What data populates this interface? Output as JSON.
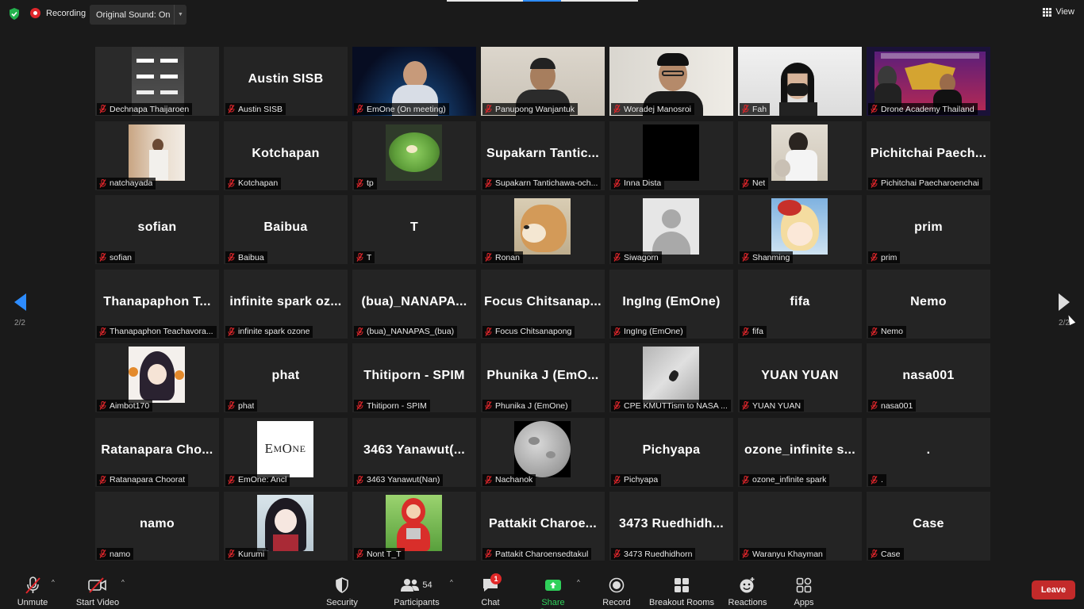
{
  "topbar": {
    "recording_label": "Recording",
    "original_sound_label": "Original Sound: On",
    "view_label": "View"
  },
  "participants": [
    {
      "big": "",
      "name": "Dechnapa Thaijaroen",
      "media": "video-lights"
    },
    {
      "big": "Austin SISB",
      "name": "Austin SISB"
    },
    {
      "big": "",
      "name": "EmOne (On meeting)",
      "media": "video-space"
    },
    {
      "big": "",
      "name": "Panupong Wanjantuk",
      "media": "video-person-light"
    },
    {
      "big": "",
      "name": "Woradej Manosroi",
      "media": "video-person-glasses"
    },
    {
      "big": "",
      "name": "Fah",
      "media": "video-person-mask"
    },
    {
      "big": "",
      "name": "Drone Academy Thailand",
      "media": "video-drone",
      "active": true
    },
    {
      "big": "",
      "name": "natchayada",
      "media": "photo-room"
    },
    {
      "big": "Kotchapan",
      "name": "Kotchapan"
    },
    {
      "big": "",
      "name": "tp",
      "media": "photo-salad"
    },
    {
      "big": "Supakarn  Tantic...",
      "name": "Supakarn Tantichawa-och..."
    },
    {
      "big": "",
      "name": "Inna Dista",
      "media": "photo-black"
    },
    {
      "big": "",
      "name": "Net",
      "media": "photo-net"
    },
    {
      "big": "Pichitchai  Paech...",
      "name": "Pichitchai Paecharoenchai"
    },
    {
      "big": "sofian",
      "name": "sofian"
    },
    {
      "big": "Baibua",
      "name": "Baibua"
    },
    {
      "big": "T",
      "name": "T"
    },
    {
      "big": "",
      "name": "Ronan",
      "media": "photo-shiba"
    },
    {
      "big": "",
      "name": "Siwagorn",
      "media": "photo-default"
    },
    {
      "big": "",
      "name": "Shanming",
      "media": "photo-anime-blonde"
    },
    {
      "big": "prim",
      "name": "prim"
    },
    {
      "big": "Thanapaphon  T...",
      "name": "Thanapaphon Teachavora..."
    },
    {
      "big": "infinite spark oz...",
      "name": "infinite spark ozone"
    },
    {
      "big": "(bua)_NANAPA...",
      "name": "(bua)_NANAPAS_(bua)"
    },
    {
      "big": "Focus  Chitsanap...",
      "name": "Focus Chitsanapong"
    },
    {
      "big": "IngIng (EmOne)",
      "name": "IngIng (EmOne)"
    },
    {
      "big": "fifa",
      "name": "fifa"
    },
    {
      "big": "Nemo",
      "name": "Nemo"
    },
    {
      "big": "",
      "name": "Aimbot170",
      "media": "photo-anime-dark"
    },
    {
      "big": "phat",
      "name": "phat"
    },
    {
      "big": "Thitiporn - SPIM",
      "name": "Thitiporn - SPIM"
    },
    {
      "big": "Phunika J (EmO...",
      "name": "Phunika J (EmOne)"
    },
    {
      "big": "",
      "name": "CPE KMUTTism to NASA ...",
      "media": "photo-gray"
    },
    {
      "big": "YUAN YUAN",
      "name": "YUAN YUAN"
    },
    {
      "big": "nasa001",
      "name": "nasa001"
    },
    {
      "big": "Ratanapara  Cho...",
      "name": "Ratanapara Choorat"
    },
    {
      "big": "",
      "name": "EmOne: Ancl",
      "media": "photo-emone"
    },
    {
      "big": "3463  Yanawut(...",
      "name": "3463 Yanawut(Nan)"
    },
    {
      "big": "",
      "name": "Nachanok",
      "media": "photo-moon"
    },
    {
      "big": "Pichyapa",
      "name": "Pichyapa"
    },
    {
      "big": "ozone_infinite  s...",
      "name": "ozone_infinite spark"
    },
    {
      "big": ".",
      "name": "."
    },
    {
      "big": "namo",
      "name": "namo"
    },
    {
      "big": "",
      "name": "Kurumi",
      "media": "photo-anime-kurumi"
    },
    {
      "big": "",
      "name": "Nont T_T",
      "media": "photo-teletubby"
    },
    {
      "big": "Pattakit  Charoe...",
      "name": "Pattakit Charoensedtakul"
    },
    {
      "big": "3473  Ruedhidh...",
      "name": "3473 Ruedhidhorn"
    },
    {
      "big": "",
      "name": "Waranyu Khayman"
    },
    {
      "big": "Case",
      "name": "Case"
    }
  ],
  "pager": {
    "left": "2/2",
    "right": "2/2"
  },
  "toolbar": {
    "unmute": "Unmute",
    "start_video": "Start Video",
    "security": "Security",
    "participants": "Participants",
    "participants_count": "54",
    "chat": "Chat",
    "chat_badge": "1",
    "share_screen": "Share Screen",
    "record": "Record",
    "breakout_rooms": "Breakout Rooms",
    "reactions": "Reactions",
    "apps": "Apps",
    "leave": "Leave"
  },
  "colors": {
    "accent": "#2d8cff",
    "share": "#2fd05a",
    "leave": "#c32a2a",
    "active_speaker": "#e6e85a",
    "muted": "#e0262b"
  }
}
